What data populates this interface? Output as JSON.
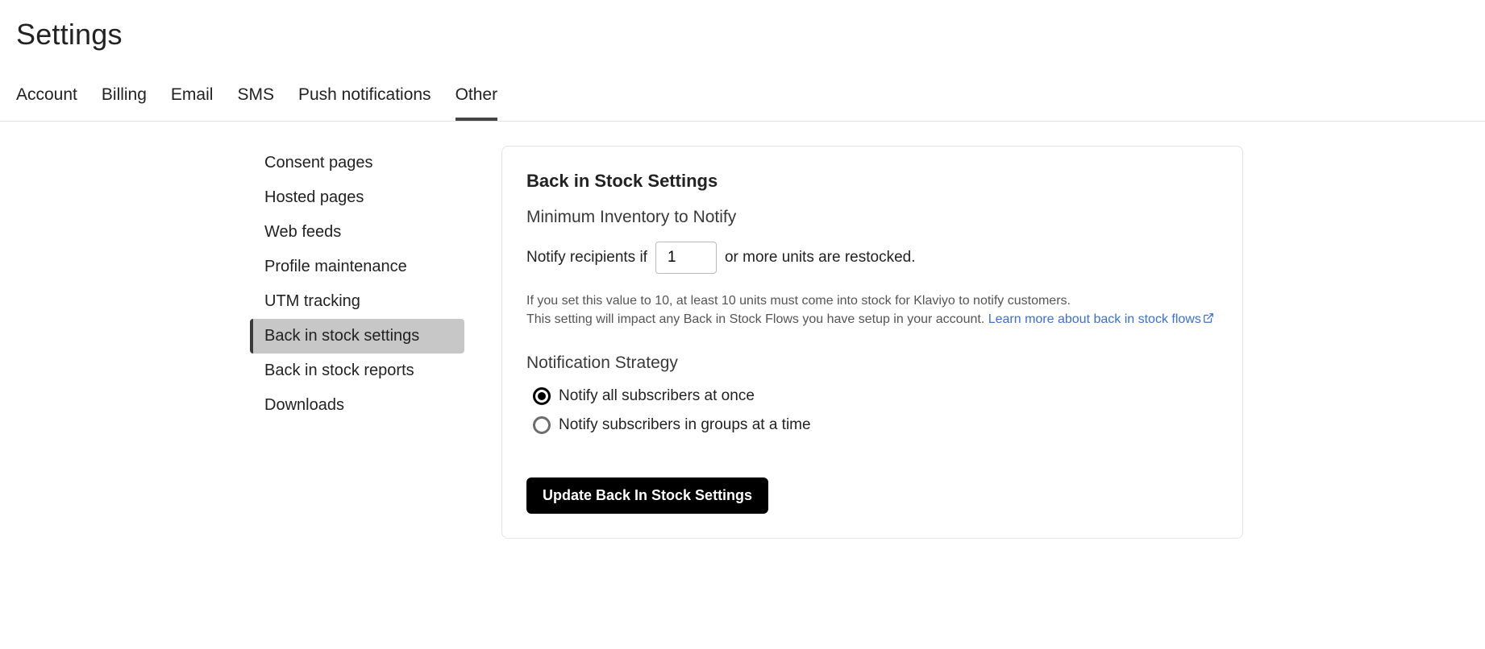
{
  "page": {
    "title": "Settings"
  },
  "tabs": [
    {
      "label": "Account",
      "active": false
    },
    {
      "label": "Billing",
      "active": false
    },
    {
      "label": "Email",
      "active": false
    },
    {
      "label": "SMS",
      "active": false
    },
    {
      "label": "Push notifications",
      "active": false
    },
    {
      "label": "Other",
      "active": true
    }
  ],
  "sidebar": {
    "items": [
      {
        "label": "Consent pages",
        "active": false
      },
      {
        "label": "Hosted pages",
        "active": false
      },
      {
        "label": "Web feeds",
        "active": false
      },
      {
        "label": "Profile maintenance",
        "active": false
      },
      {
        "label": "UTM tracking",
        "active": false
      },
      {
        "label": "Back in stock settings",
        "active": true
      },
      {
        "label": "Back in stock reports",
        "active": false
      },
      {
        "label": "Downloads",
        "active": false
      }
    ]
  },
  "panel": {
    "title": "Back in Stock Settings",
    "min_inventory": {
      "heading": "Minimum Inventory to Notify",
      "prefix": "Notify recipients if",
      "value": "1",
      "suffix": "or more units are restocked.",
      "help_line1": "If you set this value to 10, at least 10 units must come into stock for Klaviyo to notify customers.",
      "help_line2_prefix": "This setting will impact any Back in Stock Flows you have setup in your account. ",
      "help_link_text": "Learn more about back in stock flows"
    },
    "strategy": {
      "heading": "Notification Strategy",
      "options": [
        {
          "label": "Notify all subscribers at once",
          "selected": true
        },
        {
          "label": "Notify subscribers in groups at a time",
          "selected": false
        }
      ]
    },
    "submit_label": "Update Back In Stock Settings"
  }
}
